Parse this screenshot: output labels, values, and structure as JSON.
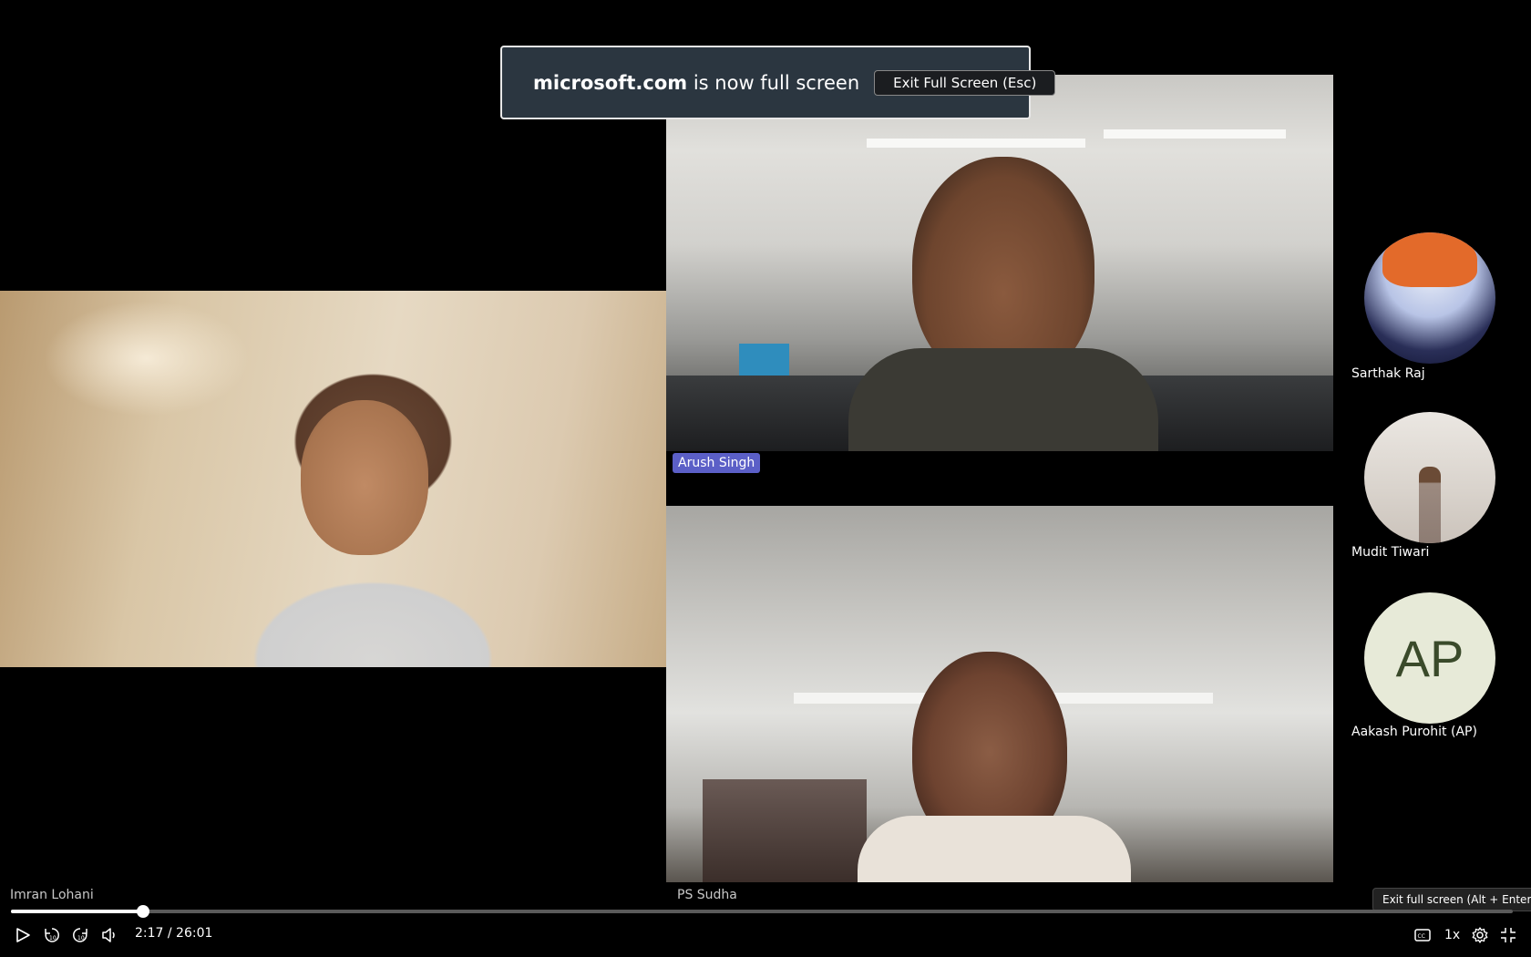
{
  "banner": {
    "domain": "microsoft.com",
    "message": " is now full screen",
    "exit_button": "Exit Full Screen (Esc)"
  },
  "participants": {
    "imran": {
      "name": "Imran Lohani"
    },
    "arush": {
      "name": "Arush Singh"
    },
    "sudha": {
      "name": "PS Sudha"
    }
  },
  "avatars": [
    {
      "name": "Sarthak Raj"
    },
    {
      "name": "Mudit Tiwari"
    },
    {
      "name": "Aakash Purohit (AP)",
      "initials": "AP"
    }
  ],
  "player": {
    "time": "2:17 / 26:01",
    "progress": 0.0878,
    "speed": "1x",
    "tooltip": "Exit full screen (Alt + Enter)",
    "icons": [
      "play-icon",
      "rewind-10-icon",
      "forward-10-icon",
      "volume-icon",
      "captions-icon",
      "settings-icon",
      "exit-fullscreen-icon"
    ]
  }
}
